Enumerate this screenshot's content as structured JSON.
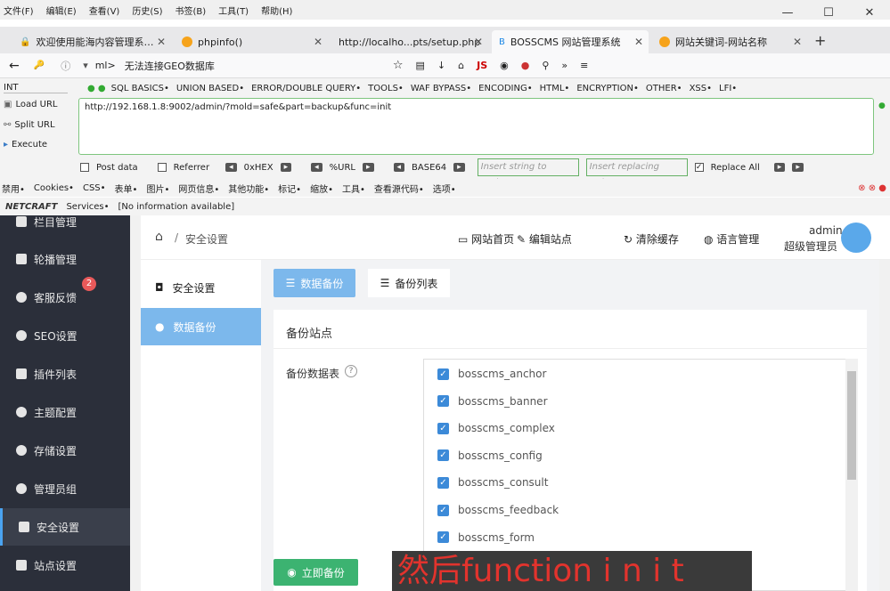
{
  "menu": [
    "文件(F)",
    "编辑(E)",
    "查看(V)",
    "历史(S)",
    "书签(B)",
    "工具(T)",
    "帮助(H)"
  ],
  "window_controls": [
    "—",
    "☐",
    "✕"
  ],
  "tabs": [
    {
      "title": "欢迎使用能海内容管理系…"
    },
    {
      "title": "phpinfo()"
    },
    {
      "title": "http://localho...pts/setup.php"
    },
    {
      "title": "BOSSCMS 网站管理系统"
    },
    {
      "title": "网站关键词-网站名称"
    }
  ],
  "navbar": {
    "lead": "ml>",
    "text": "无法连接GEO数据库"
  },
  "hackbar": {
    "type": "INT",
    "menus": [
      "SQL BASICS•",
      "UNION BASED•",
      "ERROR/DOUBLE QUERY•",
      "TOOLS•",
      "WAF BYPASS•",
      "ENCODING•",
      "HTML•",
      "ENCRYPTION•",
      "OTHER•",
      "XSS•",
      "LFI•"
    ],
    "load_url": "Load URL",
    "split_url": "Split URL",
    "execute": "Execute",
    "url": "http://192.168.1.8:9002/admin/?mold=safe&part=backup&func=init",
    "post_data": "Post data",
    "referrer": "Referrer",
    "hex": "0xHEX",
    "url_enc": "%URL",
    "base64": "BASE64",
    "insert_string": "Insert string to replace",
    "insert_replacing": "Insert replacing string",
    "replace_all": "Replace All"
  },
  "devbar": [
    "禁用•",
    "Cookies•",
    "CSS•",
    "表单•",
    "图片•",
    "网页信息•",
    "其他功能•",
    "标记•",
    "缩放•",
    "工具•",
    "查看源代码•",
    "选项•"
  ],
  "statusbar": {
    "brand": "NETCRAFT",
    "services": "Services•",
    "info": "[No information available]"
  },
  "sidebar": {
    "items": [
      {
        "label": "栏目管理"
      },
      {
        "label": "轮播管理"
      },
      {
        "label": "客服反馈",
        "badge": "2"
      },
      {
        "label": "SEO设置"
      },
      {
        "label": "插件列表"
      },
      {
        "label": "主题配置"
      },
      {
        "label": "存储设置"
      },
      {
        "label": "管理员组"
      },
      {
        "label": "安全设置"
      },
      {
        "label": "站点设置"
      }
    ]
  },
  "breadcrumb": {
    "sep": "/",
    "current": "安全设置"
  },
  "topnav": [
    "网站首页",
    "编辑站点",
    "清除缓存",
    "语言管理"
  ],
  "user": {
    "name": "admin",
    "role": "超级管理员"
  },
  "subnav": [
    "安全设置",
    "数据备份"
  ],
  "main": {
    "tabs": [
      "数据备份",
      "备份列表"
    ],
    "section_title": "备份站点",
    "field_label": "备份数据表",
    "help": "?",
    "tables": [
      "bosscms_anchor",
      "bosscms_banner",
      "bosscms_complex",
      "bosscms_config",
      "bosscms_consult",
      "bosscms_feedback",
      "bosscms_form"
    ],
    "submit": "立即备份"
  },
  "subtitle": "然后function i n i t"
}
